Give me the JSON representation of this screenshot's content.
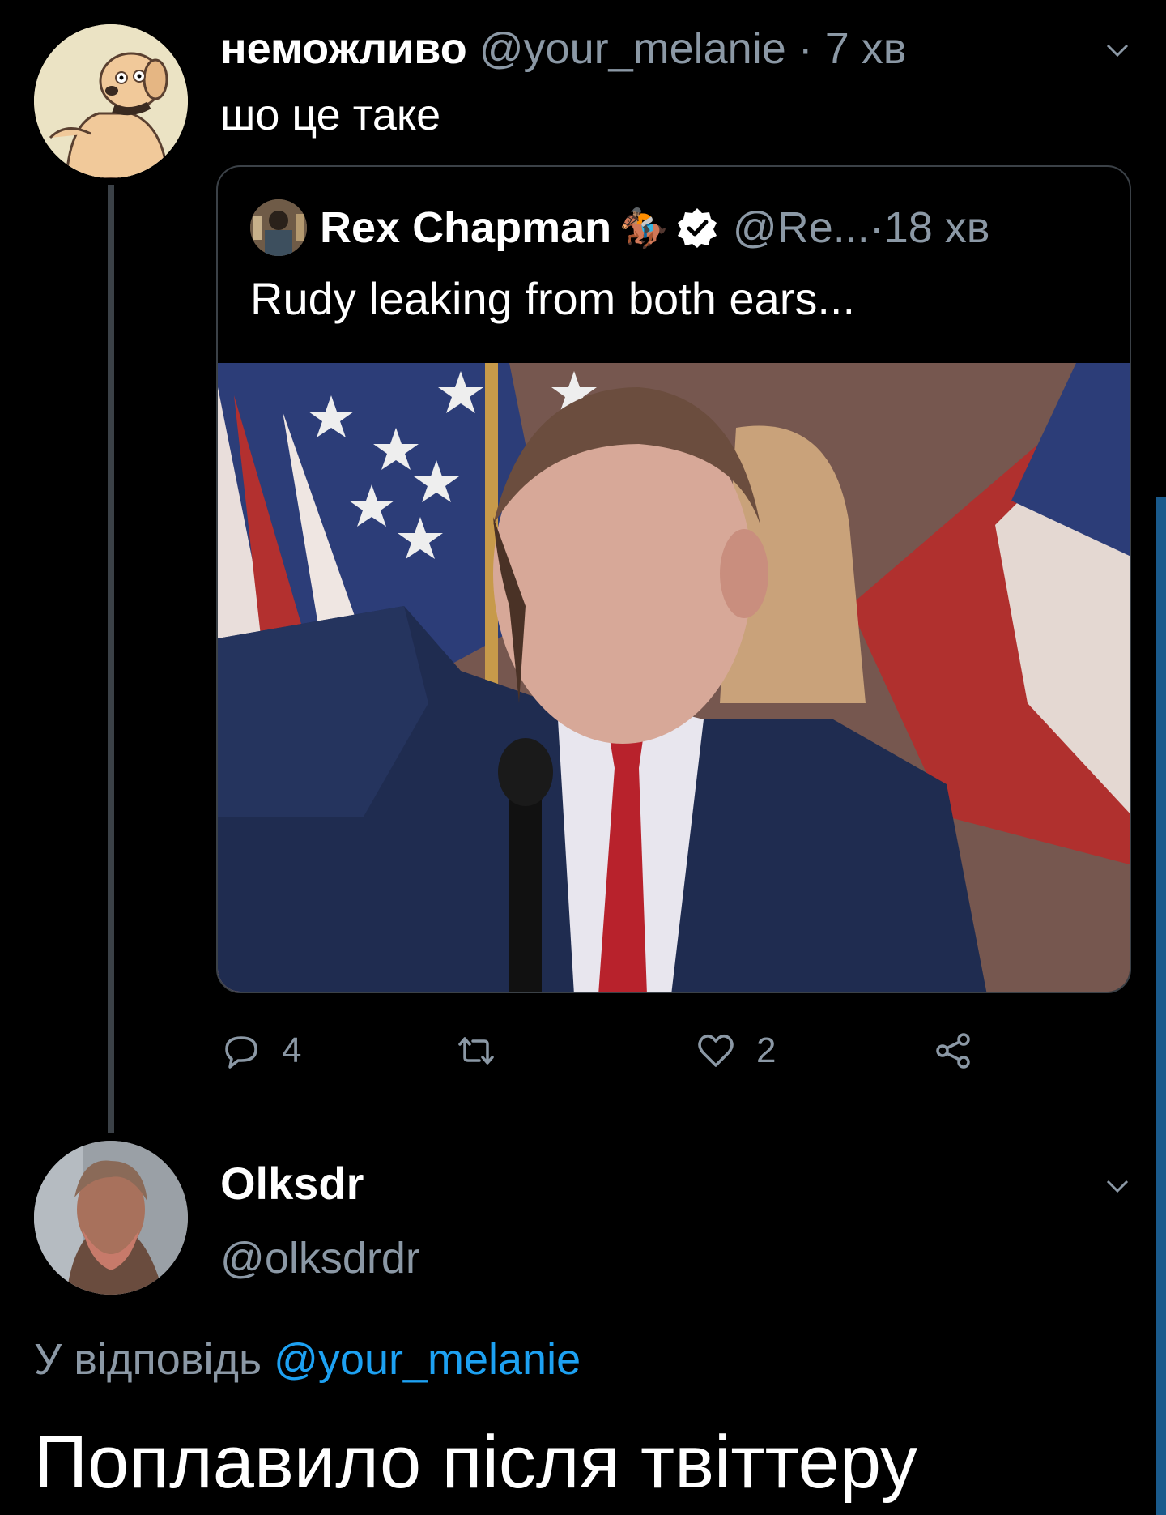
{
  "tweet1": {
    "author_name": "неможливо",
    "author_handle": "@your_melanie",
    "separator": " · ",
    "time": "7 хв",
    "text": "шо це таке",
    "quote": {
      "author_name": "Rex Chapman",
      "emoji": "🏇🏽",
      "author_handle": "@Re...",
      "separator": " · ",
      "time": "18 хв",
      "text": "Rudy leaking from both ears..."
    },
    "actions": {
      "reply_count": "4",
      "retweet_count": "",
      "like_count": "2"
    }
  },
  "tweet2": {
    "author_name": "Olksdr",
    "author_handle": "@olksdrdr",
    "reply_prefix": "У відповідь ",
    "reply_mention": "@your_melanie",
    "text": "Поплавило після твіттеру"
  },
  "colors": {
    "background": "#000000",
    "secondary_text": "#8b98a5",
    "link": "#1da1f2",
    "border": "#3b4147"
  }
}
